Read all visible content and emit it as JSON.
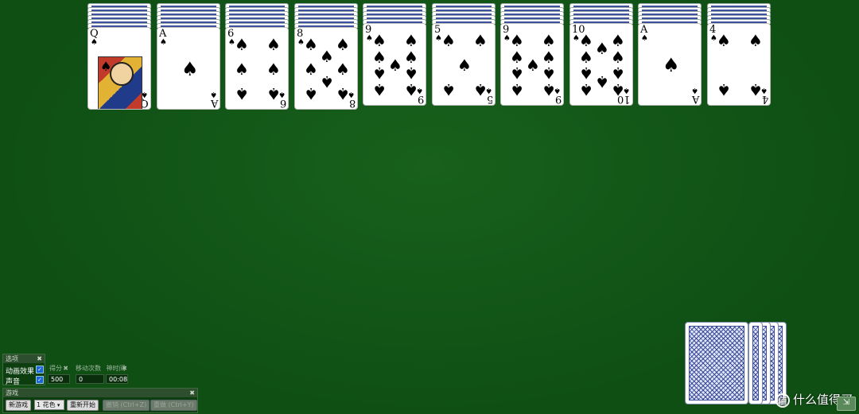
{
  "tableau": [
    {
      "rank": "Q",
      "suit": "♠",
      "type": "court"
    },
    {
      "rank": "A",
      "suit": "♠",
      "type": "ace"
    },
    {
      "rank": "6",
      "suit": "♠",
      "type": "num"
    },
    {
      "rank": "8",
      "suit": "♠",
      "type": "num"
    },
    {
      "rank": "9",
      "suit": "♠",
      "type": "num"
    },
    {
      "rank": "5",
      "suit": "♠",
      "type": "num"
    },
    {
      "rank": "9",
      "suit": "♠",
      "type": "num"
    },
    {
      "rank": "10",
      "suit": "♠",
      "type": "num"
    },
    {
      "rank": "A",
      "suit": "♠",
      "type": "ace"
    },
    {
      "rank": "4",
      "suit": "♠",
      "type": "num"
    }
  ],
  "hidden_counts": [
    6,
    6,
    6,
    6,
    5,
    5,
    5,
    5,
    5,
    5
  ],
  "stock_count": 5,
  "options_panel": {
    "title": "选项",
    "animation_label": "动画效果",
    "sound_label": "声音",
    "animation_checked": true,
    "sound_checked": true
  },
  "score_panel": {
    "title": "得分",
    "value": "500"
  },
  "moves_panel": {
    "title": "移动次数",
    "value": "0"
  },
  "time_panel": {
    "title": "神时间",
    "value": "00:08"
  },
  "game_panel": {
    "title": "游戏",
    "new_game": "新游戏",
    "suit_select": "1 花色",
    "restart": "重新开始",
    "undo": "撤销 (Ctrl+Z)",
    "redo": "重做 (Ctrl+Y)"
  },
  "watermark": "什么值得买",
  "watermark_icon": "值",
  "close_glyph": "✖"
}
